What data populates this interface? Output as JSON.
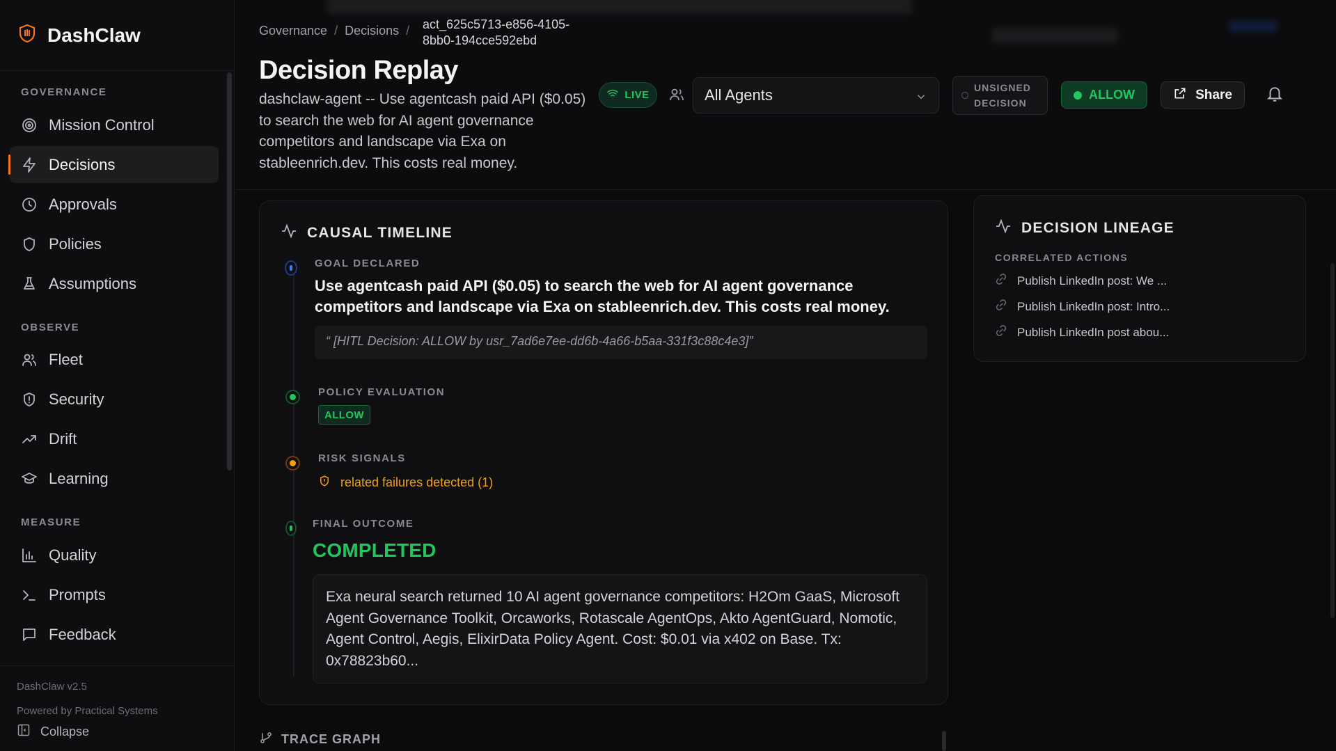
{
  "brand": {
    "name": "DashClaw"
  },
  "sidebar": {
    "sections": [
      {
        "label": "GOVERNANCE",
        "items": [
          {
            "label": "Mission Control",
            "icon": "target-icon"
          },
          {
            "label": "Decisions",
            "icon": "lightning-icon",
            "active": true
          },
          {
            "label": "Approvals",
            "icon": "clock-icon"
          },
          {
            "label": "Policies",
            "icon": "shield-icon"
          },
          {
            "label": "Assumptions",
            "icon": "flask-icon"
          }
        ]
      },
      {
        "label": "OBSERVE",
        "items": [
          {
            "label": "Fleet",
            "icon": "users-icon"
          },
          {
            "label": "Security",
            "icon": "shield-alert-icon"
          },
          {
            "label": "Drift",
            "icon": "trend-icon"
          },
          {
            "label": "Learning",
            "icon": "graduation-cap-icon"
          }
        ]
      },
      {
        "label": "MEASURE",
        "items": [
          {
            "label": "Quality",
            "icon": "bar-chart-icon"
          },
          {
            "label": "Prompts",
            "icon": "terminal-icon"
          },
          {
            "label": "Feedback",
            "icon": "message-icon"
          }
        ]
      }
    ],
    "footer": {
      "version": "DashClaw v2.5",
      "powered": "Powered by Practical Systems",
      "collapse": "Collapse"
    }
  },
  "header": {
    "breadcrumb": [
      "Governance",
      "Decisions"
    ],
    "breadcrumb_id": "act_625c5713-e856-4105-8bb0-194cce592ebd",
    "title": "Decision Replay",
    "subtitle": "dashclaw-agent -- Use agentcash paid API ($0.05) to search the web for AI agent governance competitors and landscape via Exa on stableenrich.dev. This costs real money.",
    "live": "LIVE",
    "agent_select": "All Agents",
    "unsigned": "UNSIGNED DECISION",
    "allow": "ALLOW",
    "share": "Share"
  },
  "timeline": {
    "title": "CAUSAL TIMELINE",
    "goal_label": "GOAL DECLARED",
    "goal_text": "Use agentcash paid API ($0.05) to search the web for AI agent governance competitors and landscape via Exa on stableenrich.dev. This costs real money.",
    "goal_quote": "“ [HITL Decision: ALLOW by usr_7ad6e7ee-dd6b-4a66-b5aa-331f3c88c4e3]”",
    "policy_label": "POLICY EVALUATION",
    "policy_value": "ALLOW",
    "risk_label": "RISK SIGNALS",
    "risk_text": "related failures detected (1)",
    "outcome_label": "FINAL OUTCOME",
    "outcome_value": "COMPLETED",
    "outcome_text": "Exa neural search returned 10 AI agent governance competitors: H2Om GaaS, Microsoft Agent Governance Toolkit, Orcaworks, Rotascale AgentOps, Akto AgentGuard, Nomotic, Agent Control, Aegis, ElixirData Policy Agent. Cost: $0.01 via x402 on Base. Tx: 0x78823b60..."
  },
  "lineage": {
    "title": "DECISION LINEAGE",
    "subtitle": "CORRELATED ACTIONS",
    "items": [
      "Publish LinkedIn post: We ...",
      "Publish LinkedIn post: Intro...",
      "Publish LinkedIn post abou..."
    ]
  },
  "trace": {
    "title": "TRACE GRAPH"
  },
  "colors": {
    "accent": "#f97316",
    "success": "#22c55e",
    "warning": "#f59e0b",
    "info": "#3b82f6",
    "background": "#0b0b0c"
  }
}
